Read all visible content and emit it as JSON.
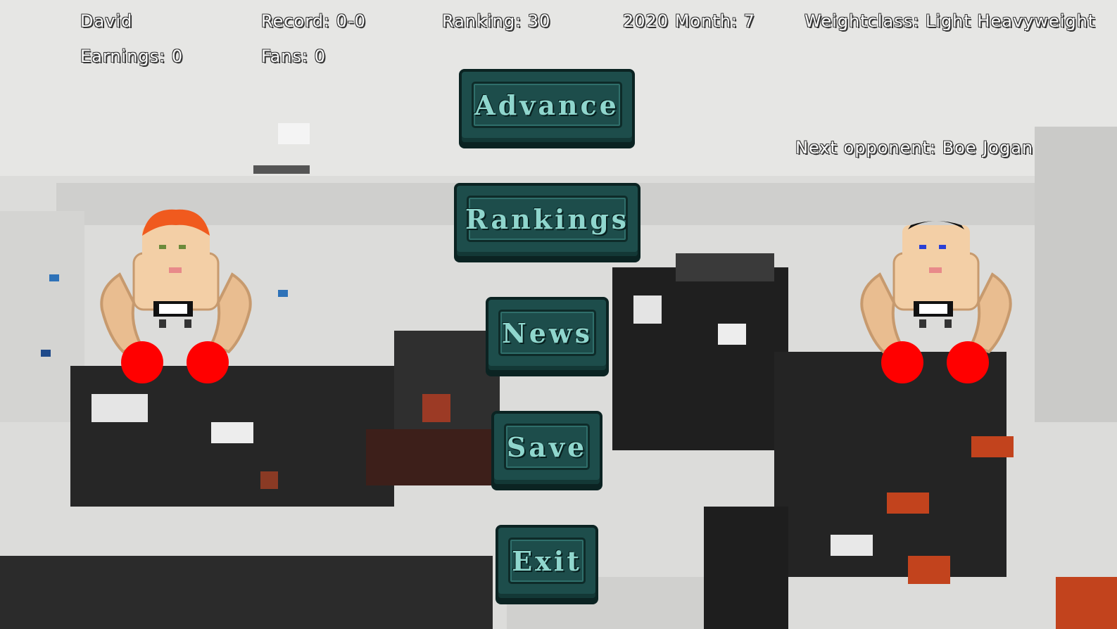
{
  "hud": {
    "name": "David",
    "record": "Record: 0-0",
    "ranking": "Ranking: 30",
    "date": "2020 Month: 7",
    "weightclass": "Weightclass: Light Heavyweight",
    "earnings": "Earnings: 0",
    "fans": "Fans: 0"
  },
  "next_opponent": "Next opponent: Boe Jogan",
  "menu": {
    "advance": "Advance",
    "rankings": "Rankings",
    "news": "News",
    "save": "Save",
    "exit": "Exit"
  },
  "colors": {
    "button_bg": "#1d4d4b",
    "button_text": "#8fd6cd",
    "glove": "#ff0000",
    "player_hair": "#f05a1e",
    "opponent_hair": "#111111"
  }
}
